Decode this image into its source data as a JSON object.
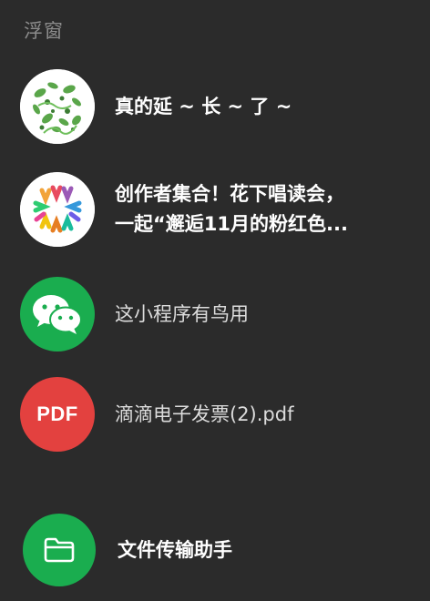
{
  "panel": {
    "title": "浮窗"
  },
  "items": [
    {
      "label": "真的延 ~ 长 ~ 了 ~",
      "icon": "plant-pattern-avatar"
    },
    {
      "label_line1": "创作者集合！花下唱读会，",
      "label_line2": "一起“邂逅11月的粉红色...",
      "icon": "colorful-petals-avatar"
    },
    {
      "label": "这小程序有鸟用",
      "icon": "wechat-icon"
    },
    {
      "label": "滴滴电子发票(2).pdf",
      "icon": "pdf-icon",
      "icon_text": "PDF"
    },
    {
      "label": "文件传输助手",
      "icon": "folder-icon"
    }
  ],
  "colors": {
    "background": "#2b2b2b",
    "wechat_green": "#1aad4f",
    "pdf_red": "#e3413f",
    "title_gray": "#8c8c8c"
  }
}
